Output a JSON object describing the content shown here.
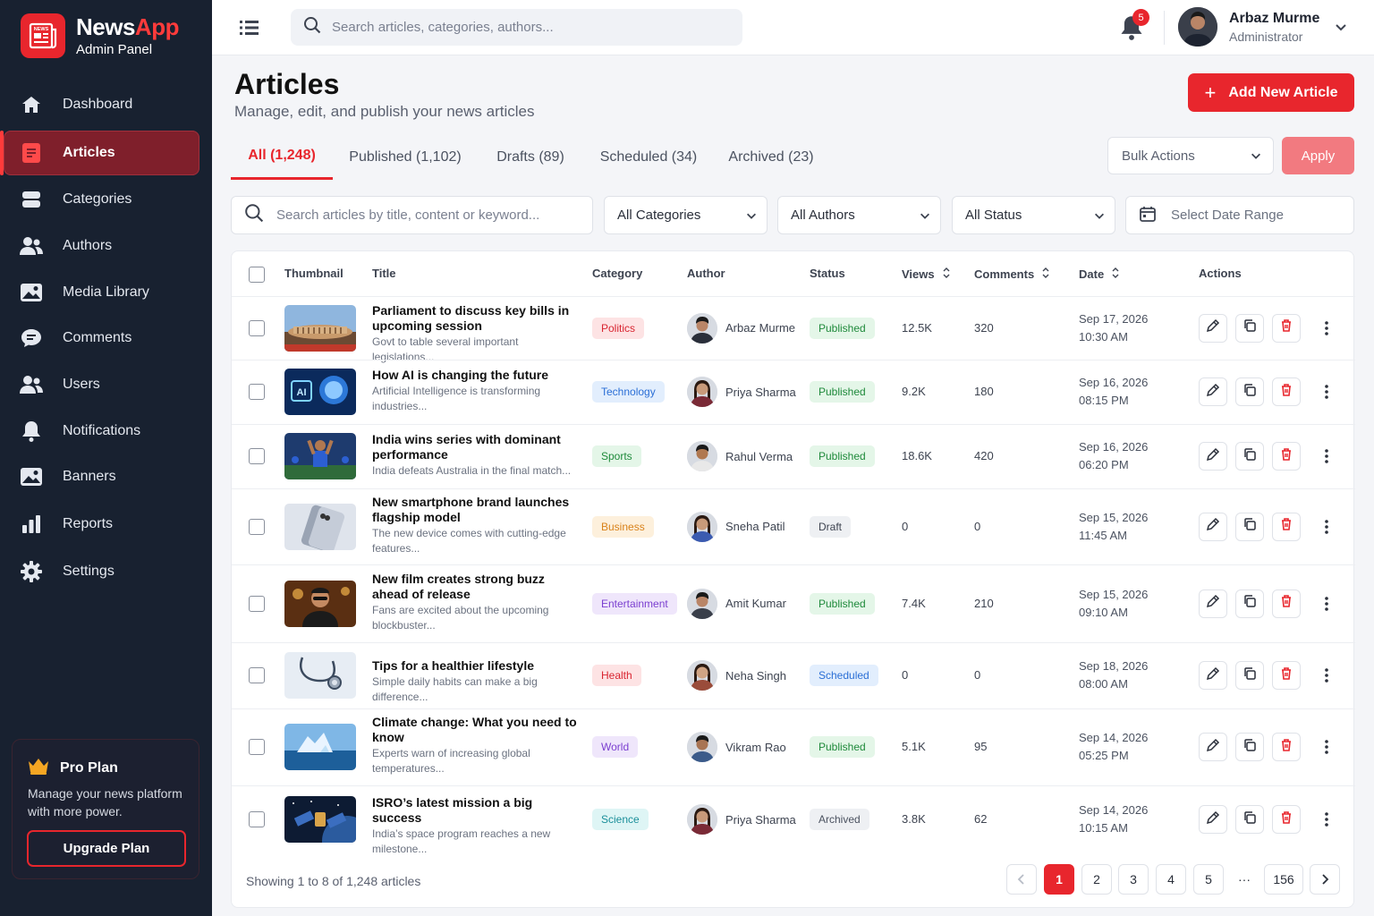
{
  "brand": {
    "name_part1": "News",
    "name_part2": "App",
    "subtitle": "Admin Panel",
    "logo_text": "NEWS"
  },
  "sidebar": {
    "items": [
      {
        "label": "Dashboard",
        "icon": "home-icon"
      },
      {
        "label": "Articles",
        "icon": "article-icon",
        "active": true
      },
      {
        "label": "Categories",
        "icon": "categories-icon"
      },
      {
        "label": "Authors",
        "icon": "authors-icon"
      },
      {
        "label": "Media Library",
        "icon": "image-icon"
      },
      {
        "label": "Comments",
        "icon": "comment-icon"
      },
      {
        "label": "Users",
        "icon": "users-icon"
      },
      {
        "label": "Notifications",
        "icon": "bell-icon"
      },
      {
        "label": "Banners",
        "icon": "banner-icon"
      },
      {
        "label": "Reports",
        "icon": "bar-chart-icon"
      },
      {
        "label": "Settings",
        "icon": "gear-icon"
      }
    ],
    "pro": {
      "title": "Pro Plan",
      "desc": "Manage your news platform with more power.",
      "button": "Upgrade Plan"
    }
  },
  "topbar": {
    "search_placeholder": "Search articles, categories, authors...",
    "notification_count": "5",
    "user_name": "Arbaz Murme",
    "user_role": "Administrator"
  },
  "page": {
    "title": "Articles",
    "subtitle": "Manage, edit, and publish your news articles",
    "add_button": "Add New Article"
  },
  "tabs": [
    "All (1,248)",
    "Published (1,102)",
    "Drafts (89)",
    "Scheduled (34)",
    "Archived (23)"
  ],
  "bulk": {
    "label": "Bulk Actions",
    "apply": "Apply"
  },
  "filters": {
    "search_placeholder": "Search articles by title, content or keyword...",
    "category": "All Categories",
    "author": "All Authors",
    "status": "All Status",
    "date": "Select Date Range"
  },
  "table": {
    "headers": [
      "Thumbnail",
      "Title",
      "Category",
      "Author",
      "Status",
      "Views",
      "Comments",
      "Date",
      "Actions"
    ],
    "rows": [
      {
        "title": "Parliament to discuss key bills in upcoming session",
        "desc": "Govt to table several important legislations...",
        "category": "Politics",
        "author": "Arbaz Murme",
        "status": "Published",
        "views": "12.5K",
        "comments": "320",
        "date": "Sep 17, 2026",
        "time": "10:30 AM"
      },
      {
        "title": "How AI is changing the future",
        "desc": "Artificial Intelligence is transforming industries...",
        "category": "Technology",
        "author": "Priya Sharma",
        "status": "Published",
        "views": "9.2K",
        "comments": "180",
        "date": "Sep 16, 2026",
        "time": "08:15 PM"
      },
      {
        "title": "India wins series with dominant performance",
        "desc": "India defeats Australia in the final match...",
        "category": "Sports",
        "author": "Rahul Verma",
        "status": "Published",
        "views": "18.6K",
        "comments": "420",
        "date": "Sep 16, 2026",
        "time": "06:20 PM"
      },
      {
        "title": "New smartphone brand launches flagship model",
        "desc": "The new device comes with cutting-edge features...",
        "category": "Business",
        "author": "Sneha Patil",
        "status": "Draft",
        "views": "0",
        "comments": "0",
        "date": "Sep 15, 2026",
        "time": "11:45 AM"
      },
      {
        "title": "New film creates strong buzz ahead of release",
        "desc": "Fans are excited about the upcoming blockbuster...",
        "category": "Entertainment",
        "author": "Amit Kumar",
        "status": "Published",
        "views": "7.4K",
        "comments": "210",
        "date": "Sep 15, 2026",
        "time": "09:10 AM"
      },
      {
        "title": "Tips for a healthier lifestyle",
        "desc": "Simple daily habits can make a big difference...",
        "category": "Health",
        "author": "Neha Singh",
        "status": "Scheduled",
        "views": "0",
        "comments": "0",
        "date": "Sep 18, 2026",
        "time": "08:00 AM"
      },
      {
        "title": "Climate change: What you need to know",
        "desc": "Experts warn of increasing global temperatures...",
        "category": "World",
        "author": "Vikram Rao",
        "status": "Published",
        "views": "5.1K",
        "comments": "95",
        "date": "Sep 14, 2026",
        "time": "05:25 PM"
      },
      {
        "title": "ISRO’s latest mission a big success",
        "desc": "India’s space program reaches a new milestone...",
        "category": "Science",
        "author": "Priya Sharma",
        "status": "Archived",
        "views": "3.8K",
        "comments": "62",
        "date": "Sep 14, 2026",
        "time": "10:15 AM"
      }
    ]
  },
  "pagination": {
    "showing": "Showing 1 to 8 of 1,248 articles",
    "pages": [
      "1",
      "2",
      "3",
      "4",
      "5",
      "···",
      "156"
    ]
  },
  "colors": {
    "accent": "#e8262d",
    "sidebar_bg": "#182130"
  }
}
